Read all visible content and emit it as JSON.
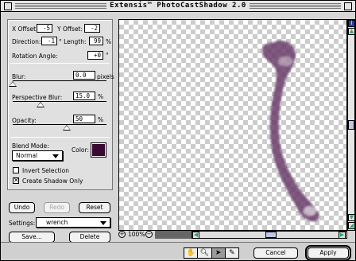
{
  "window": {
    "title": "Extensis™ PhotoCastShadow 2.0"
  },
  "panel": {
    "x_offset_label": "X Offset:",
    "x_offset_value": "-5",
    "y_offset_label": "Y Offset:",
    "y_offset_value": "-2",
    "direction_label": "Direction:",
    "direction_value": "-1",
    "degree_length_label": "° Length:",
    "length_value": "99",
    "length_unit": "%",
    "rotation_label": "Rotation Angle:",
    "rotation_value": "+0",
    "rotation_unit": "°",
    "blur_label": "Blur:",
    "blur_value": "0.0",
    "blur_unit": "pixels",
    "blur_slider_level": 0.0,
    "perspective_label": "Perspective Blur:",
    "perspective_value": "15.0",
    "perspective_unit": "%",
    "perspective_slider_level": 0.15,
    "opacity_label": "Opacity:",
    "opacity_value": "50",
    "opacity_unit": "%",
    "opacity_slider_level": 0.5,
    "blend_label": "Blend Mode:",
    "blend_value": "Normal",
    "color_label": "Color:",
    "color_value": "#3a0a33",
    "invert_label": "Invert Selection",
    "invert_checked": false,
    "shadow_only_label": "Create Shadow Only",
    "shadow_only_checked": true
  },
  "buttons": {
    "undo": "Undo",
    "redo": "Redo",
    "reset": "Reset",
    "save": "Save...",
    "delete": "Delete",
    "cancel": "Cancel",
    "apply": "Apply"
  },
  "settings": {
    "label": "Settings:",
    "value": "wrench"
  },
  "zoom": {
    "value": "100%"
  },
  "icons": {
    "zoom_in": "plus-icon",
    "zoom_out": "minus-icon",
    "hand": "hand-icon",
    "magnify": "magnifier-icon",
    "move": "move-arrow-icon",
    "eyedropper": "eyedropper-icon"
  },
  "colors": {
    "shadow": "#6b3d6b"
  }
}
